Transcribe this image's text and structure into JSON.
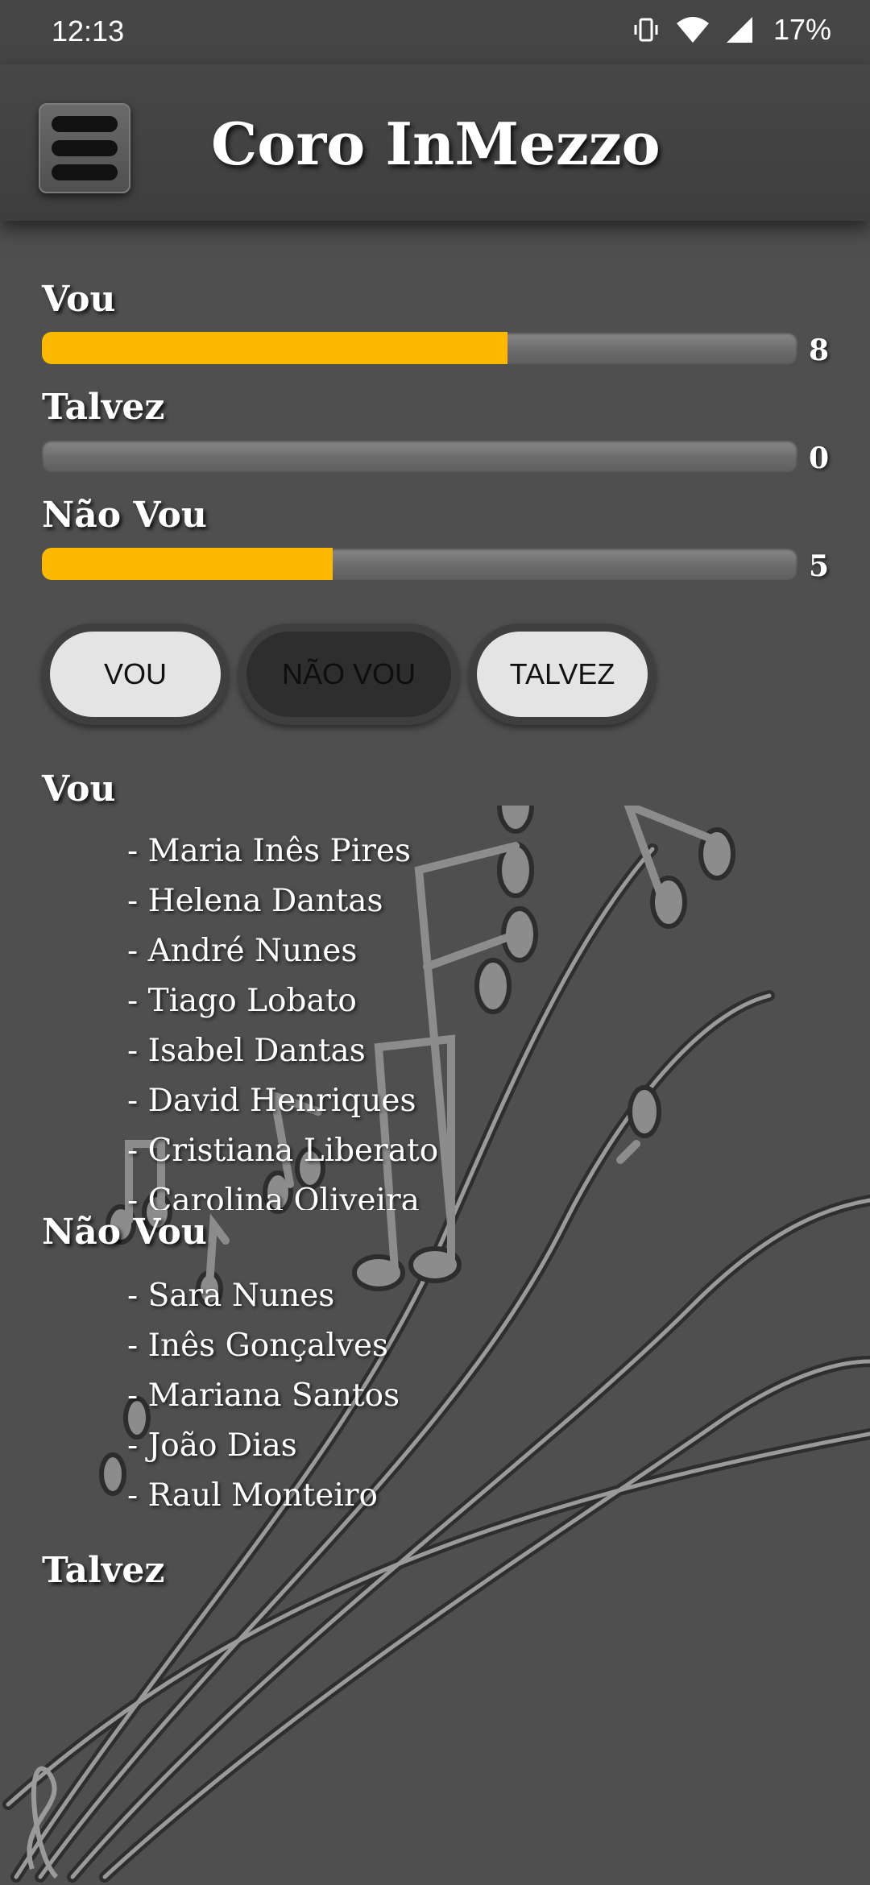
{
  "status_bar": {
    "time": "12:13",
    "battery": "17%"
  },
  "app_bar": {
    "title": "Coro InMezzo"
  },
  "stats": [
    {
      "label": "Vou",
      "count": "8",
      "fill_fraction": 0.616,
      "fill_color": "#fdb900"
    },
    {
      "label": "Talvez",
      "count": "0",
      "fill_fraction": 0,
      "fill_color": "#fdb900"
    },
    {
      "label": "Não Vou",
      "count": "5",
      "fill_fraction": 0.385,
      "fill_color": "#fdb900"
    }
  ],
  "buttons": {
    "vou": "VOU",
    "nao_vou": "NÃO VOU",
    "talvez": "TALVEZ"
  },
  "lists": {
    "vou": {
      "title": "Vou",
      "names": [
        "- Maria Inês Pires",
        "- Helena Dantas",
        "- André Nunes",
        "- Tiago Lobato",
        "- Isabel Dantas",
        "- David Henriques",
        "- Cristiana Liberato",
        "- Carolina Oliveira"
      ]
    },
    "nao_vou": {
      "title": "Não Vou",
      "names": [
        "- Sara Nunes",
        "- Inês Gonçalves",
        "- Mariana Santos",
        "- João Dias",
        "- Raul Monteiro"
      ]
    },
    "talvez": {
      "title": "Talvez",
      "names": []
    }
  },
  "colors": {
    "background": "#4f4f4f",
    "accent": "#fdb900"
  }
}
